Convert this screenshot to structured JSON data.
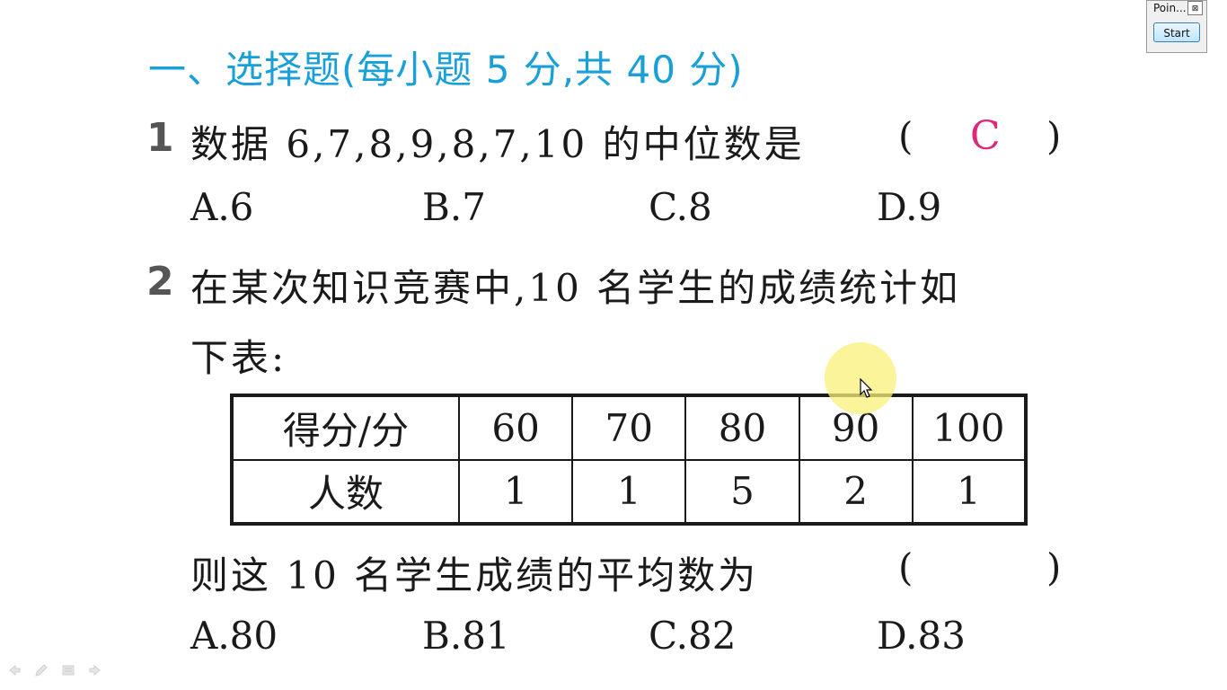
{
  "section_header": "一、选择题(每小题 5 分,共 40 分)",
  "q1": {
    "number": "1",
    "text": "数据 6,7,8,9,8,7,10 的中位数是",
    "paren_open": "(",
    "answer": "C",
    "paren_close": ")",
    "options": [
      "A.6",
      "B.7",
      "C.8",
      "D.9"
    ]
  },
  "q2": {
    "number": "2",
    "text_line1": "在某次知识竞赛中,10 名学生的成绩统计如",
    "text_line2": "下表:",
    "table": {
      "headers": [
        "得分/分",
        "60",
        "70",
        "80",
        "90",
        "100"
      ],
      "row": [
        "人数",
        "1",
        "1",
        "5",
        "2",
        "1"
      ]
    },
    "question": "则这 10 名学生成绩的平均数为",
    "paren_open": "(",
    "paren_close": ")",
    "options": [
      "A.80",
      "B.81",
      "C.82",
      "D.83"
    ]
  },
  "pointer_window": {
    "title": "Poin...",
    "close": "⊠",
    "start_label": "Start"
  },
  "colors": {
    "section": "#1aa0d8",
    "answer": "#e0287a",
    "highlight": "#faf078"
  },
  "icons": [
    "nav-prev-icon",
    "pen-icon",
    "menu-icon",
    "nav-next-icon",
    "mouse-cursor-icon"
  ]
}
